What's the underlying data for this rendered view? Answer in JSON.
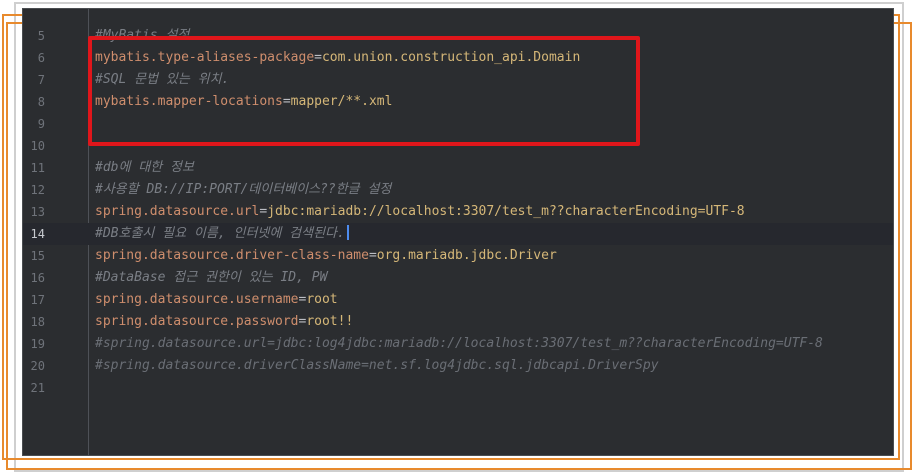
{
  "editor": {
    "lines": [
      {
        "num": "5",
        "kind": "comment",
        "text": "#MyBatis 설정"
      },
      {
        "num": "6",
        "kind": "prop",
        "key": "mybatis.type-aliases-package",
        "value": "com.union.construction_api.Domain"
      },
      {
        "num": "7",
        "kind": "comment",
        "text": "#SQL 문법 있는 위치."
      },
      {
        "num": "8",
        "kind": "prop",
        "key": "mybatis.mapper-locations",
        "value": "mapper/**.xml"
      },
      {
        "num": "9",
        "kind": "empty"
      },
      {
        "num": "10",
        "kind": "empty"
      },
      {
        "num": "11",
        "kind": "comment",
        "text": "#db에 대한 정보"
      },
      {
        "num": "12",
        "kind": "comment",
        "text": "#사용할 DB://IP:PORT/데이터베이스??한글 설정"
      },
      {
        "num": "13",
        "kind": "prop",
        "key": "spring.datasource.url",
        "value": "jdbc:mariadb://localhost:3307/test_m??characterEncoding=UTF-8"
      },
      {
        "num": "14",
        "kind": "comment",
        "text": "#DB호출시 필요 이름, 인터넷에 검색된다.",
        "current": true
      },
      {
        "num": "15",
        "kind": "prop",
        "key": "spring.datasource.driver-class-name",
        "value": "org.mariadb.jdbc.Driver"
      },
      {
        "num": "16",
        "kind": "comment",
        "text": "#DataBase 접근 권한이 있는 ID, PW"
      },
      {
        "num": "17",
        "kind": "prop",
        "key": "spring.datasource.username",
        "value": "root"
      },
      {
        "num": "18",
        "kind": "prop",
        "key": "spring.datasource.password",
        "value": "root!!"
      },
      {
        "num": "19",
        "kind": "comment-faded",
        "text": "#spring.datasource.url=jdbc:log4jdbc:mariadb://localhost:3307/test_m??characterEncoding=UTF-8"
      },
      {
        "num": "20",
        "kind": "comment-faded",
        "text": "#spring.datasource.driverClassName=net.sf.log4jdbc.sql.jdbcapi.DriverSpy"
      },
      {
        "num": "21",
        "kind": "empty"
      }
    ],
    "equals": "="
  },
  "colors": {
    "background": "#2b2d30",
    "key": "#cf8e6d",
    "value": "#d5b778",
    "comment": "#7a7e85",
    "highlight_box": "#e0161b",
    "frame_accent": "#e88a2d"
  }
}
